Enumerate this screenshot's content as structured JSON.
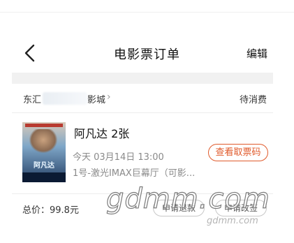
{
  "nav": {
    "title": "电影票订单",
    "edit_label": "编辑",
    "back_icon": "chevron-left-icon"
  },
  "order": {
    "cinema_prefix": "东汇",
    "cinema_suffix": "影城",
    "status": "待消费",
    "movie_title": "阿凡达 2张",
    "show_time": "今天 03月14日 13:00",
    "hall": "1号-激光IMAX巨幕厅（可影...",
    "view_ticket_button": "查看取票码",
    "total_label": "总价：99.8元",
    "refund_button": "申请退款",
    "change_button": "申请改签",
    "poster_title": "阿凡达"
  },
  "watermark": {
    "large": "gdmm.com",
    "small": "gdmm.com"
  },
  "colors": {
    "accent": "#e05a2b",
    "muted_text": "#8a8a8a",
    "band": "#f1f1f1"
  }
}
